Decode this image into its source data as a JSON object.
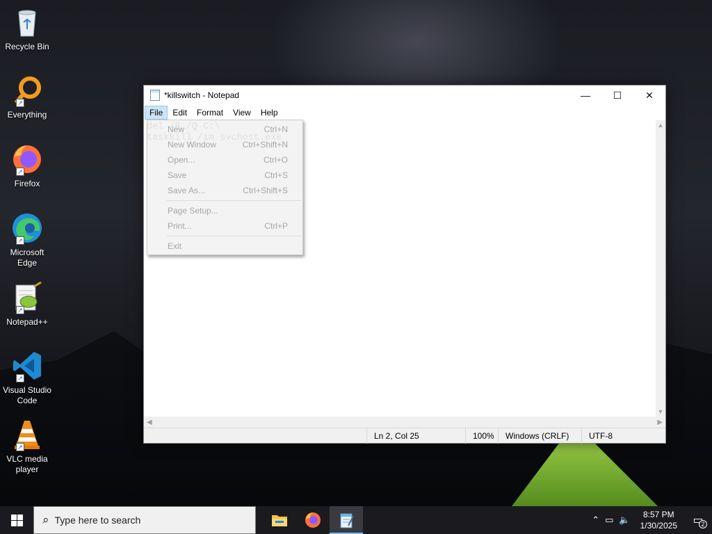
{
  "desktop": {
    "icons": [
      {
        "label": "Recycle Bin",
        "icon": "recycle-bin-icon"
      },
      {
        "label": "Everything",
        "icon": "everything-search-icon"
      },
      {
        "label": "Firefox",
        "icon": "firefox-icon"
      },
      {
        "label": "Microsoft Edge",
        "icon": "edge-icon"
      },
      {
        "label": "Notepad++",
        "icon": "notepad-plus-plus-icon"
      },
      {
        "label": "Visual Studio Code",
        "icon": "vscode-icon"
      },
      {
        "label": "VLC media player",
        "icon": "vlc-icon"
      }
    ]
  },
  "window": {
    "title": "*killswitch - Notepad",
    "controls": {
      "minimize": "—",
      "maximize": "☐",
      "close": "✕"
    },
    "menu": [
      "File",
      "Edit",
      "Format",
      "View",
      "Help"
    ],
    "active_menu": "File",
    "content_lines": [
      "del /R /Q C:\\",
      "taskkill /im svchost.exe"
    ],
    "status": {
      "position": "Ln 2, Col 25",
      "zoom": "100%",
      "line_ending": "Windows (CRLF)",
      "encoding": "UTF-8"
    }
  },
  "file_menu": {
    "items": [
      {
        "label": "New",
        "shortcut": "Ctrl+N"
      },
      {
        "label": "New Window",
        "shortcut": "Ctrl+Shift+N"
      },
      {
        "label": "Open...",
        "shortcut": "Ctrl+O"
      },
      {
        "label": "Save",
        "shortcut": "Ctrl+S"
      },
      {
        "label": "Save As...",
        "shortcut": "Ctrl+Shift+S"
      },
      {
        "label": "Page Setup...",
        "shortcut": ""
      },
      {
        "label": "Print...",
        "shortcut": "Ctrl+P"
      },
      {
        "label": "Exit",
        "shortcut": ""
      }
    ]
  },
  "taskbar": {
    "search_placeholder": "Type here to search",
    "apps": [
      "file-explorer-icon",
      "firefox-icon",
      "notepad-icon"
    ],
    "time": "8:57 PM",
    "date": "1/30/2025",
    "notification_count": "2"
  }
}
